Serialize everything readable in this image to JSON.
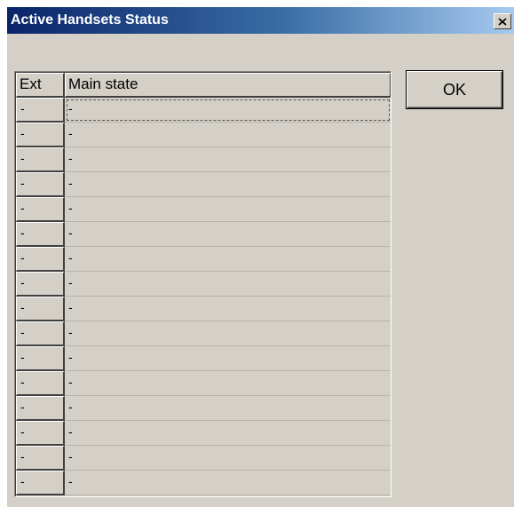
{
  "window": {
    "title": "Active Handsets Status",
    "close_glyph": "✕"
  },
  "table": {
    "columns": [
      "Ext",
      "Main state"
    ],
    "rows": [
      {
        "ext": "-",
        "main_state": "-"
      },
      {
        "ext": "-",
        "main_state": "-"
      },
      {
        "ext": "-",
        "main_state": "-"
      },
      {
        "ext": "-",
        "main_state": "-"
      },
      {
        "ext": "-",
        "main_state": "-"
      },
      {
        "ext": "-",
        "main_state": "-"
      },
      {
        "ext": "-",
        "main_state": "-"
      },
      {
        "ext": "-",
        "main_state": "-"
      },
      {
        "ext": "-",
        "main_state": "-"
      },
      {
        "ext": "-",
        "main_state": "-"
      },
      {
        "ext": "-",
        "main_state": "-"
      },
      {
        "ext": "-",
        "main_state": "-"
      },
      {
        "ext": "-",
        "main_state": "-"
      },
      {
        "ext": "-",
        "main_state": "-"
      },
      {
        "ext": "-",
        "main_state": "-"
      },
      {
        "ext": "-",
        "main_state": "-"
      }
    ]
  },
  "buttons": {
    "ok_label": "OK"
  },
  "colors": {
    "dialog_face": "#d4d0c8",
    "title_start": "#0a246a",
    "title_end": "#a6caf0"
  }
}
